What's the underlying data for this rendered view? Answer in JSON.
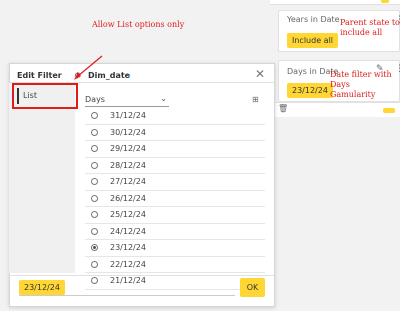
{
  "annotations": {
    "allow_list": "Allow List options only",
    "parent_state": "Parent state to include all",
    "date_filter": "Date filter with Days Gamularity"
  },
  "right_cards": {
    "card1": {
      "title": "Years in Date",
      "chip": "Include all"
    },
    "card2": {
      "title": "Days in Date",
      "chip": "23/12/24"
    }
  },
  "dialog": {
    "title": "Edit Filter",
    "field_name": "Dim_date",
    "sidebar_item": "List",
    "granularity": "Days",
    "selected_value": "23/12/24",
    "ok_label": "OK",
    "dates": [
      {
        "label": "31/12/24",
        "selected": false
      },
      {
        "label": "30/12/24",
        "selected": false
      },
      {
        "label": "29/12/24",
        "selected": false
      },
      {
        "label": "28/12/24",
        "selected": false
      },
      {
        "label": "27/12/24",
        "selected": false
      },
      {
        "label": "26/12/24",
        "selected": false
      },
      {
        "label": "25/12/24",
        "selected": false
      },
      {
        "label": "24/12/24",
        "selected": false
      },
      {
        "label": "23/12/24",
        "selected": true
      },
      {
        "label": "22/12/24",
        "selected": false
      },
      {
        "label": "21/12/24",
        "selected": false
      }
    ]
  },
  "colors": {
    "accent": "#ffd633",
    "annotation": "#e01b1b",
    "link": "#2e86de"
  }
}
